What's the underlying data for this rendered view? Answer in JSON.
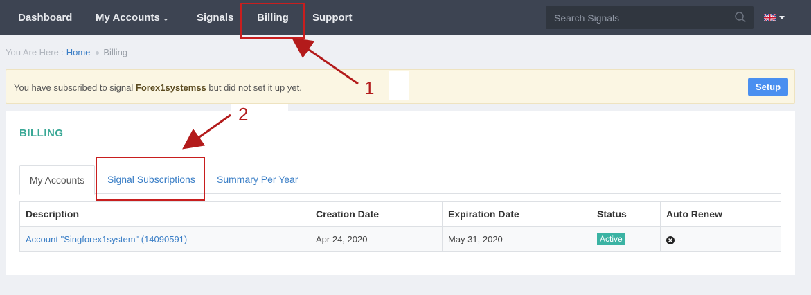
{
  "nav": {
    "items": [
      {
        "label": "Dashboard"
      },
      {
        "label": "My Accounts"
      },
      {
        "label": "Signals"
      },
      {
        "label": "Billing"
      },
      {
        "label": "Support"
      }
    ],
    "search_placeholder": "Search Signals",
    "search_icon": "search-icon",
    "language_flag": "uk-flag-icon"
  },
  "breadcrumb": {
    "prefix": "You Are Here :",
    "home": "Home",
    "current": "Billing"
  },
  "alert": {
    "text_before": "You have subscribed to signal ",
    "signal_name": "Forex1systemss",
    "text_after": " but did not set it up yet.",
    "button_label": "Setup"
  },
  "billing": {
    "title": "BILLING",
    "tabs": [
      {
        "label": "My Accounts",
        "active": true
      },
      {
        "label": "Signal Subscriptions",
        "active": false
      },
      {
        "label": "Summary Per Year",
        "active": false
      }
    ],
    "columns": [
      "Description",
      "Creation Date",
      "Expiration Date",
      "Status",
      "Auto Renew"
    ],
    "rows": [
      {
        "description": "Account \"Singforex1system\" (14090591)",
        "creation_date": "Apr 24, 2020",
        "expiration_date": "May 31, 2020",
        "status": "Active",
        "auto_renew_icon": "remove-circle-icon"
      }
    ]
  },
  "annotations": {
    "labels": [
      "1",
      "2"
    ],
    "color": "#c81e1e"
  },
  "colors": {
    "nav_bg": "#3d4452",
    "accent_teal": "#3aa896",
    "link_blue": "#3a7ec6",
    "button_blue": "#4a8ff0",
    "badge_teal": "#3bb3a3",
    "alert_bg": "#fbf6e3"
  }
}
